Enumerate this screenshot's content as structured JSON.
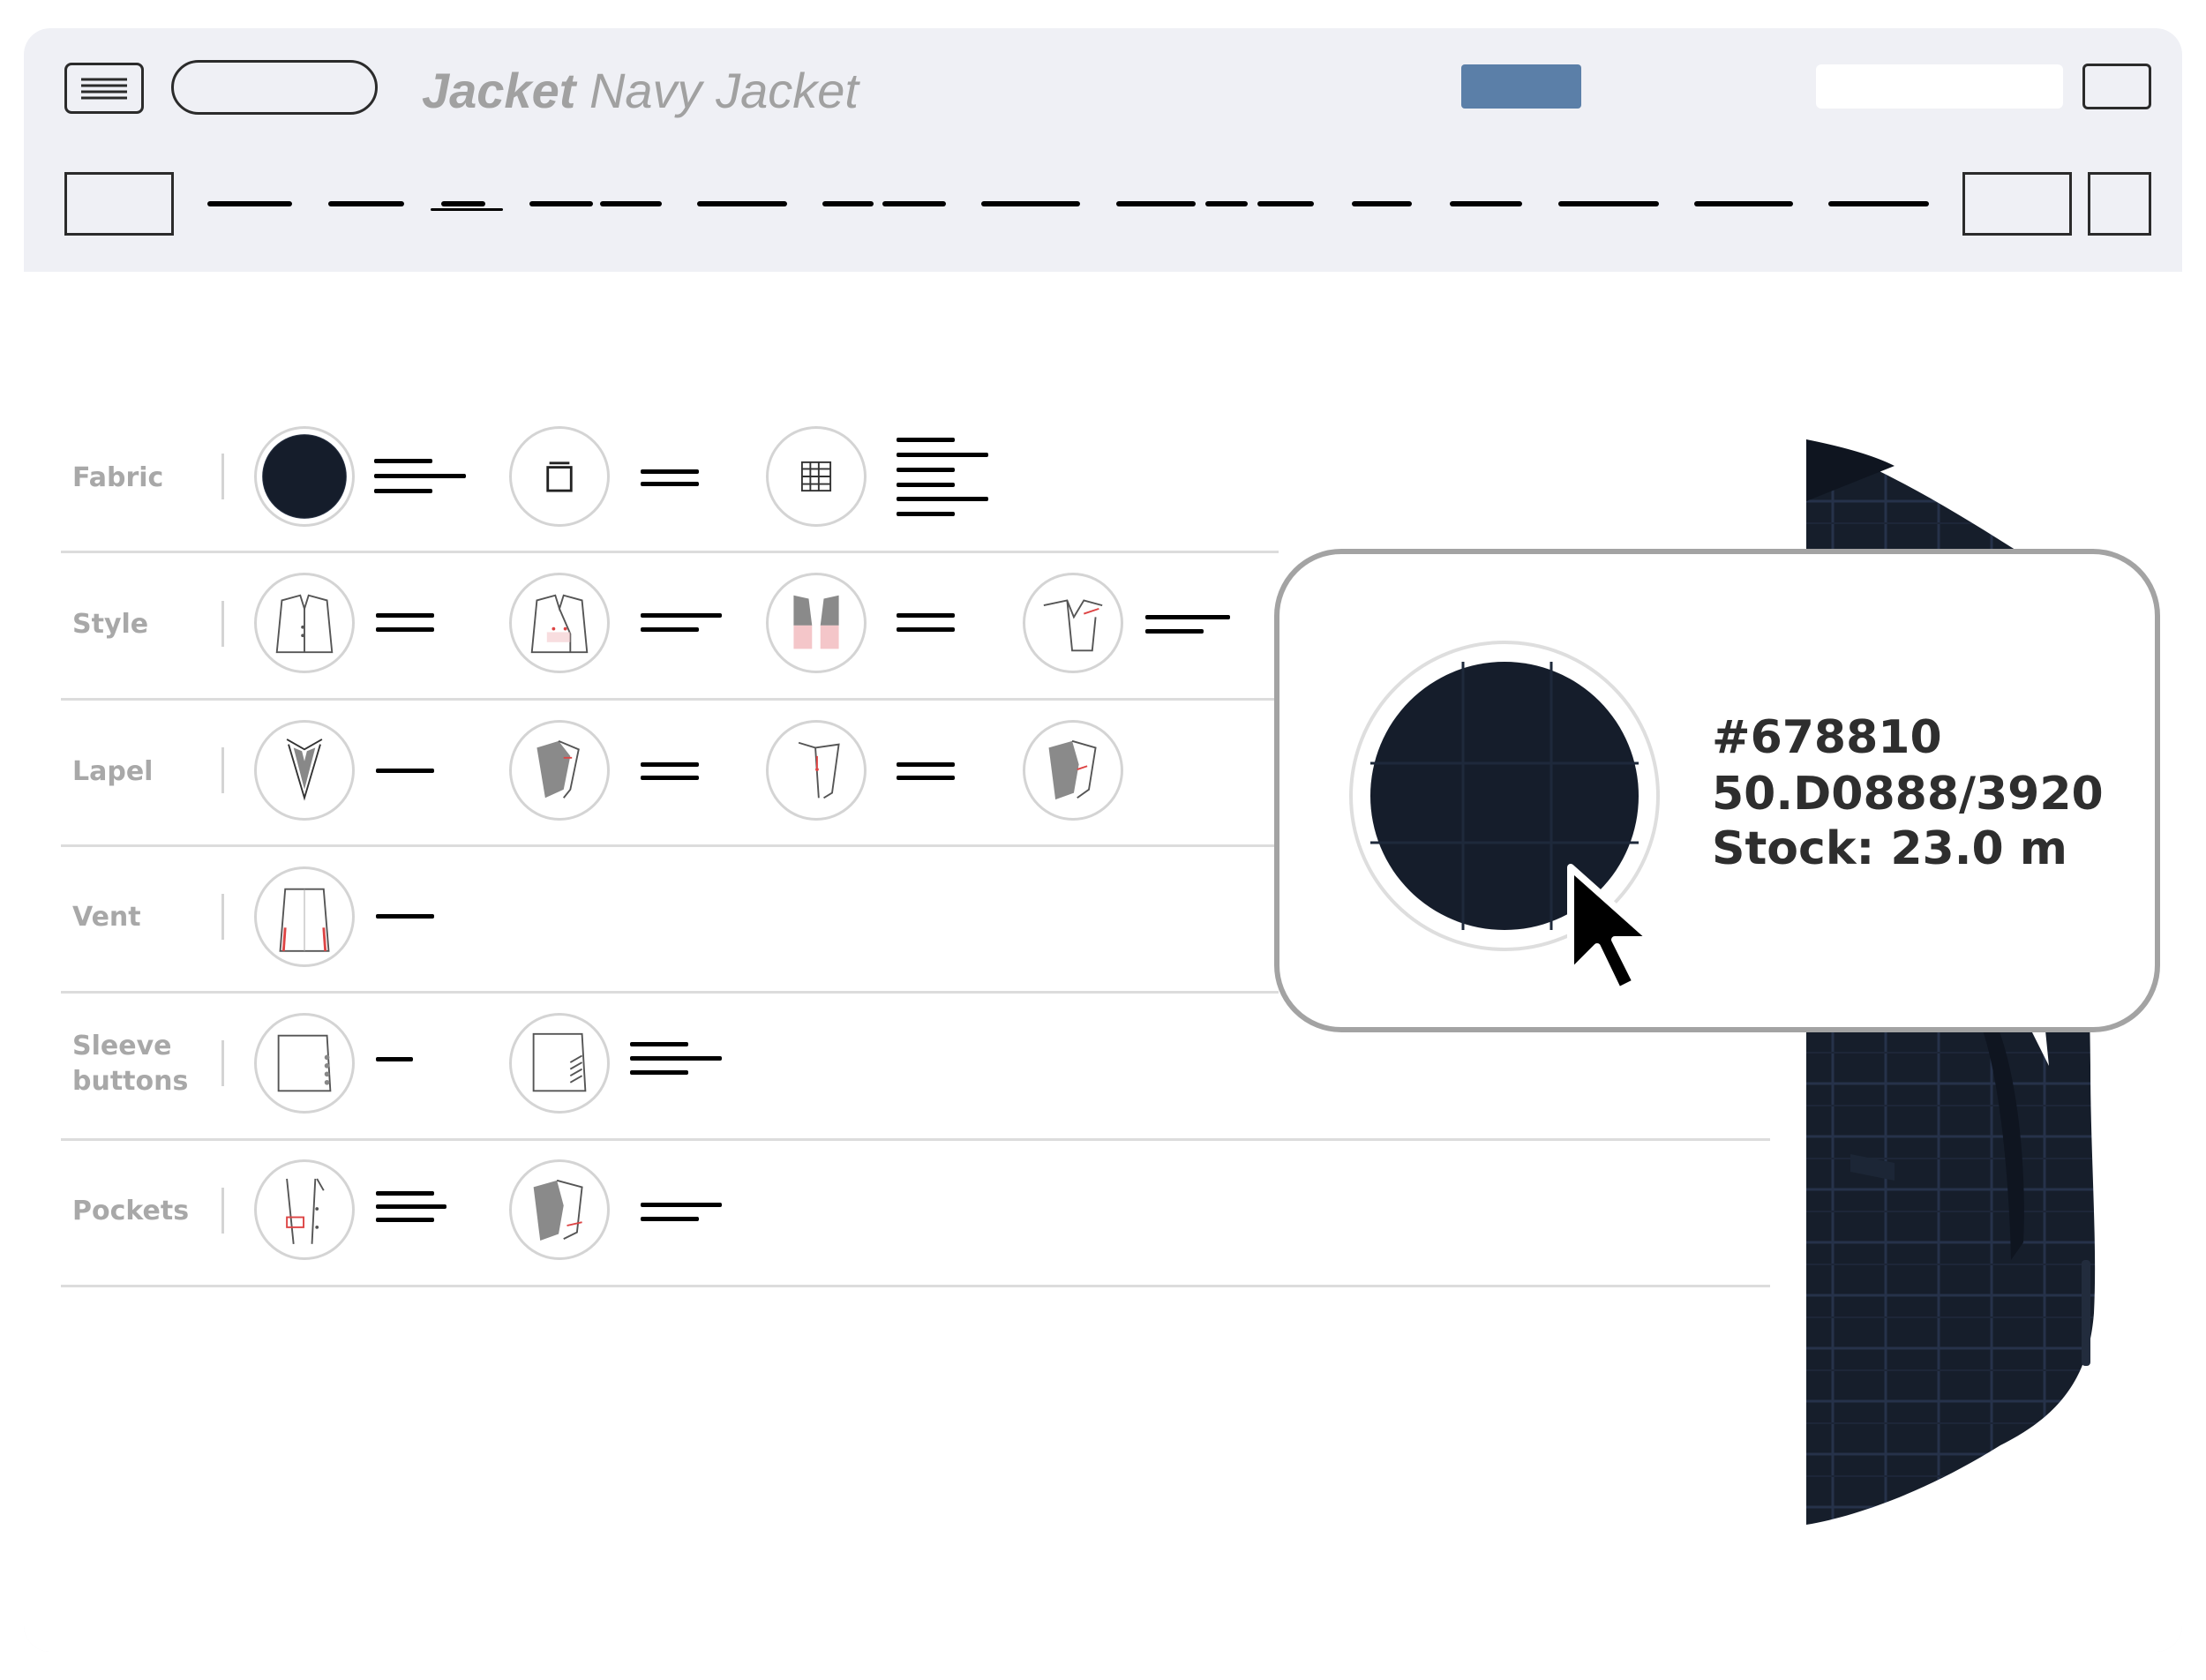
{
  "window": {
    "title_bold": "Jacket",
    "title_rest": "Navy Jacket",
    "accent_button_color": "#5b7fa8"
  },
  "rows": [
    {
      "label": "Fabric"
    },
    {
      "label": "Style"
    },
    {
      "label": "Lapel"
    },
    {
      "label": "Vent"
    },
    {
      "label_line1": "Sleeve",
      "label_line2": "buttons"
    },
    {
      "label": "Pockets"
    }
  ],
  "fabric_popup": {
    "code": "#678810",
    "article": "50.D0888/3920",
    "stock": "Stock: 23.0 m",
    "swatch_color": "#151d2b"
  },
  "icons": {
    "menu": "menu-icon",
    "cursor": "cursor-arrow-icon",
    "jacket": "navy-jacket-preview"
  }
}
